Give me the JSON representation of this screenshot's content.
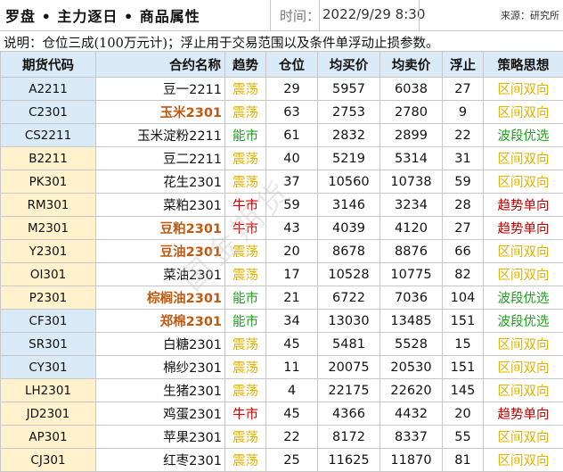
{
  "header": {
    "title": "罗盘 • 主力逐日 • 商品属性",
    "time_label": "时间：",
    "time_value": "2022/9/29 8:30",
    "source": "来源：研究所"
  },
  "note": "说明：仓位三成(100万元计)；浮止用于交易范围以及条件单浮动止损参数。",
  "watermark": "国金期货",
  "columns": [
    "期货代码",
    "合约名称",
    "趋势",
    "仓位",
    "均买价",
    "均卖价",
    "浮止",
    "策略思想"
  ],
  "colors": {
    "header_bg": "#daeaf6",
    "code_blue_bg": "#daeaf6",
    "code_yellow_bg": "#fff2cc",
    "trend_oscillate": "#e1b200",
    "trend_bull": "#d40000",
    "trend_energy": "#21a020",
    "strategy_range": "#e1b200",
    "strategy_trend": "#c00000",
    "strategy_wave": "#21a020",
    "highlight_name": "#c05a10"
  },
  "rows": [
    {
      "code": "A2211",
      "name": "豆一2211",
      "trend": "震荡",
      "pos": "29",
      "buy": "5957",
      "sell": "6038",
      "stop": "27",
      "strategy": "区间双向",
      "group": "blue",
      "hl": false
    },
    {
      "code": "C2301",
      "name": "玉米2301",
      "trend": "震荡",
      "pos": "63",
      "buy": "2753",
      "sell": "2780",
      "stop": "9",
      "strategy": "区间双向",
      "group": "blue",
      "hl": true
    },
    {
      "code": "CS2211",
      "name": "玉米淀粉2211",
      "trend": "能市",
      "pos": "61",
      "buy": "2832",
      "sell": "2899",
      "stop": "22",
      "strategy": "波段优选",
      "group": "blue",
      "hl": false
    },
    {
      "code": "B2211",
      "name": "豆二2211",
      "trend": "震荡",
      "pos": "40",
      "buy": "5219",
      "sell": "5314",
      "stop": "31",
      "strategy": "区间双向",
      "group": "yellow",
      "hl": false
    },
    {
      "code": "PK301",
      "name": "花生2301",
      "trend": "震荡",
      "pos": "37",
      "buy": "10560",
      "sell": "10738",
      "stop": "59",
      "strategy": "区间双向",
      "group": "yellow",
      "hl": false
    },
    {
      "code": "RM301",
      "name": "菜粕2301",
      "trend": "牛市",
      "pos": "59",
      "buy": "3146",
      "sell": "3234",
      "stop": "28",
      "strategy": "趋势单向",
      "group": "yellow",
      "hl": false
    },
    {
      "code": "M2301",
      "name": "豆粕2301",
      "trend": "牛市",
      "pos": "43",
      "buy": "4039",
      "sell": "4120",
      "stop": "27",
      "strategy": "趋势单向",
      "group": "yellow",
      "hl": true
    },
    {
      "code": "Y2301",
      "name": "豆油2301",
      "trend": "震荡",
      "pos": "20",
      "buy": "8678",
      "sell": "8876",
      "stop": "66",
      "strategy": "区间双向",
      "group": "yellow",
      "hl": true
    },
    {
      "code": "OI301",
      "name": "菜油2301",
      "trend": "震荡",
      "pos": "17",
      "buy": "10528",
      "sell": "10775",
      "stop": "82",
      "strategy": "区间双向",
      "group": "yellow",
      "hl": false
    },
    {
      "code": "P2301",
      "name": "棕榈油2301",
      "trend": "能市",
      "pos": "21",
      "buy": "6722",
      "sell": "7036",
      "stop": "104",
      "strategy": "波段优选",
      "group": "yellow",
      "hl": true
    },
    {
      "code": "CF301",
      "name": "郑棉2301",
      "trend": "能市",
      "pos": "34",
      "buy": "13030",
      "sell": "13485",
      "stop": "151",
      "strategy": "波段优选",
      "group": "blue",
      "hl": true
    },
    {
      "code": "SR301",
      "name": "白糖2301",
      "trend": "震荡",
      "pos": "45",
      "buy": "5481",
      "sell": "5528",
      "stop": "15",
      "strategy": "区间双向",
      "group": "blue",
      "hl": false
    },
    {
      "code": "CY301",
      "name": "棉纱2301",
      "trend": "震荡",
      "pos": "11",
      "buy": "20075",
      "sell": "20530",
      "stop": "151",
      "strategy": "区间双向",
      "group": "blue",
      "hl": false
    },
    {
      "code": "LH2301",
      "name": "生猪2301",
      "trend": "震荡",
      "pos": "4",
      "buy": "22175",
      "sell": "22620",
      "stop": "145",
      "strategy": "区间双向",
      "group": "yellow",
      "hl": false
    },
    {
      "code": "JD2301",
      "name": "鸡蛋2301",
      "trend": "牛市",
      "pos": "45",
      "buy": "4366",
      "sell": "4432",
      "stop": "20",
      "strategy": "趋势单向",
      "group": "yellow",
      "hl": false
    },
    {
      "code": "AP301",
      "name": "苹果2301",
      "trend": "震荡",
      "pos": "22",
      "buy": "8172",
      "sell": "8337",
      "stop": "55",
      "strategy": "区间双向",
      "group": "yellow",
      "hl": false
    },
    {
      "code": "CJ301",
      "name": "红枣2301",
      "trend": "震荡",
      "pos": "25",
      "buy": "11625",
      "sell": "11870",
      "stop": "81",
      "strategy": "区间双向",
      "group": "yellow",
      "hl": false
    }
  ]
}
